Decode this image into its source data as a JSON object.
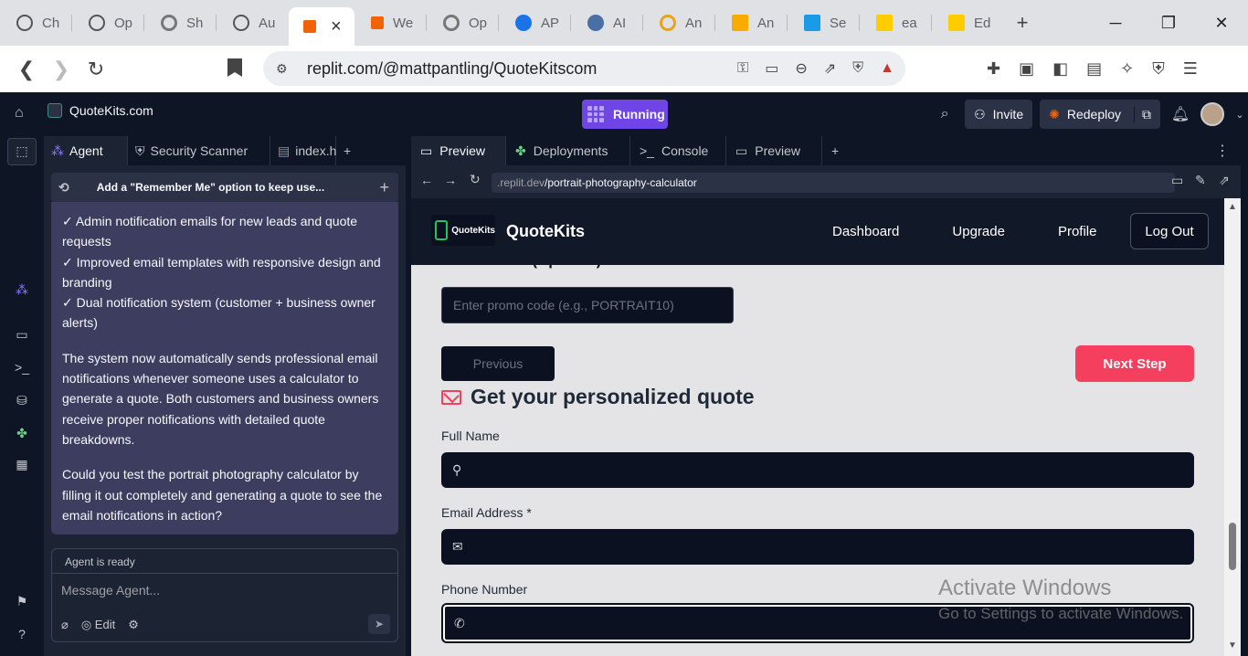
{
  "browser": {
    "tabs": [
      {
        "title": "Ch",
        "color": "#555"
      },
      {
        "title": "Op",
        "color": "#555"
      },
      {
        "title": "Sh",
        "color": "#777"
      },
      {
        "title": "Au",
        "color": "#555"
      },
      {
        "title": "",
        "color": "#f26207",
        "active": true
      },
      {
        "title": "We",
        "color": "#f26207"
      },
      {
        "title": "Op",
        "color": "#777"
      },
      {
        "title": "AP",
        "color": "#1a73e8"
      },
      {
        "title": "AI",
        "color": "#4a6fa5"
      },
      {
        "title": "An",
        "color": "#e8a317"
      },
      {
        "title": "An",
        "color": "#f9ab00"
      },
      {
        "title": "Se",
        "color": "#1a9be8"
      },
      {
        "title": "ea",
        "color": "#ffcc00"
      },
      {
        "title": "Ed",
        "color": "#ffcc00"
      }
    ],
    "active_close": "×",
    "new_tab": "+",
    "address": "replit.com/@mattpantling/QuoteKitscom"
  },
  "replit": {
    "project_name": "QuoteKits.com",
    "run_status": "Running",
    "invite_label": "Invite",
    "redeploy_label": "Redeploy"
  },
  "agent_panel": {
    "tabs": [
      {
        "label": "Agent"
      },
      {
        "label": "Security Scanner"
      },
      {
        "label": "index.h"
      }
    ],
    "chat_title": "Add a \"Remember Me\" option to keep use...",
    "messages": [
      "✓ Admin notification emails for new leads and quote requests",
      "✓ Improved email templates with responsive design and branding",
      "✓ Dual notification system (customer + business owner alerts)",
      "The system now automatically sends professional email notifications whenever someone uses a calculator to generate a quote. Both customers and business owners receive proper notifications with detailed quote breakdowns.",
      "Could you test the portrait photography calculator by filling it out completely and generating a quote to see the email notifications in action?"
    ],
    "status": "Agent is ready",
    "input_placeholder": "Message Agent...",
    "edit_label": "Edit"
  },
  "right_panel": {
    "tabs": [
      {
        "label": "Preview"
      },
      {
        "label": "Deployments"
      },
      {
        "label": "Console"
      },
      {
        "label": "Preview"
      }
    ],
    "url_domain": ".replit.dev",
    "url_path": "/portrait-photography-calculator"
  },
  "app": {
    "logo_text": "QuoteKits",
    "name": "QuoteKits",
    "nav": [
      "Dashboard",
      "Upgrade",
      "Profile"
    ],
    "logout": "Log Out",
    "promo_label": "Promo Code (Optional)",
    "promo_placeholder": "Enter promo code (e.g., PORTRAIT10)",
    "previous": "Previous",
    "next": "Next Step",
    "quote_heading": "Get your personalized quote",
    "full_name_label": "Full Name",
    "email_label": "Email Address *",
    "phone_label": "Phone Number",
    "accent_color": "#f43f5e"
  },
  "watermark": {
    "line1": "Activate Windows",
    "line2": "Go to Settings to activate Windows."
  }
}
